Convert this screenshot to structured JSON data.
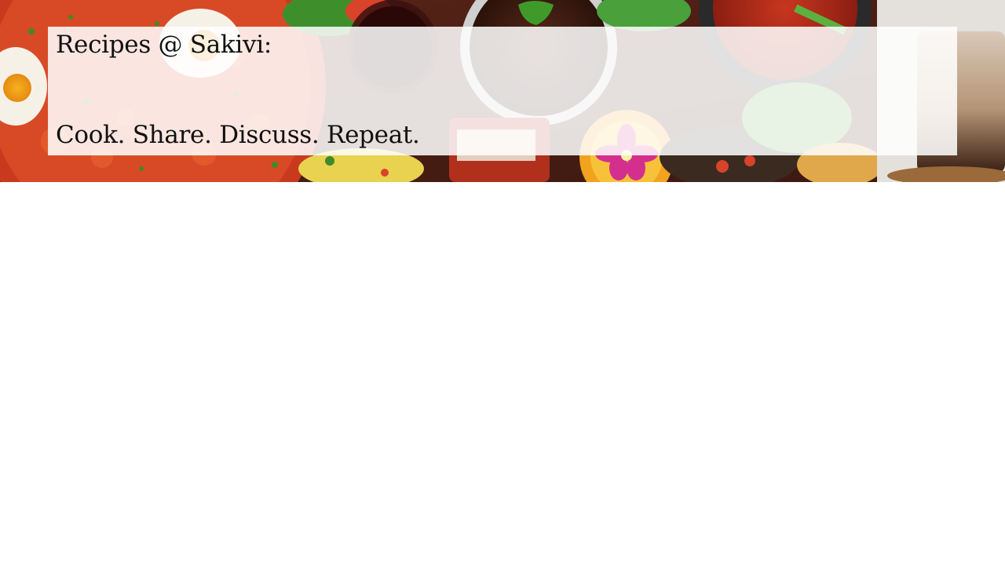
{
  "hero": {
    "headline": "Recipes @ Sakivi:",
    "tagline": "Cook. Share. Discuss. Repeat."
  },
  "colors": {
    "page_background": "#ffffff",
    "caption_text": "#111111",
    "caption_box": "#ffffff"
  }
}
